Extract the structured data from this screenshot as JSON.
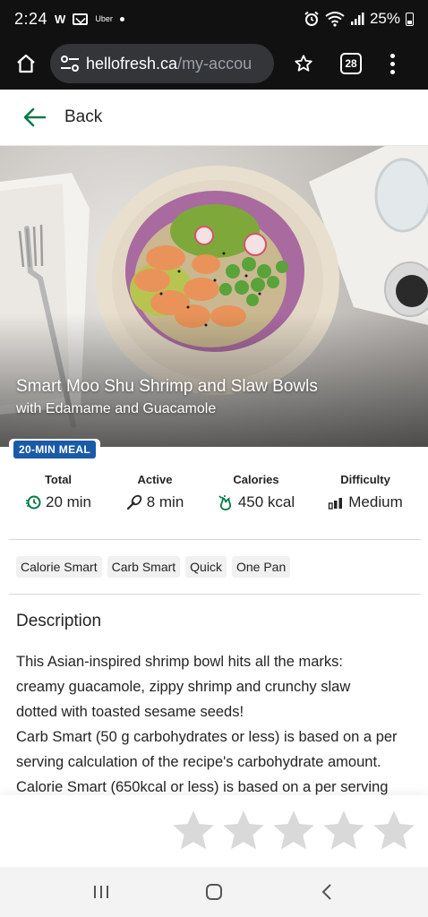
{
  "status_bar": {
    "time": "2:24",
    "app_letter": "W",
    "uber_label": "Uber",
    "battery": "25%"
  },
  "browser": {
    "url_host": "hellofresh.ca",
    "url_path": "/my-accou",
    "tab_count": "28",
    "icons": [
      "home-icon",
      "site-settings-icon",
      "bookmark-star-icon",
      "tab-switcher-icon",
      "overflow-menu-icon"
    ]
  },
  "nav": {
    "back_label": "Back"
  },
  "recipe": {
    "title": "Smart Moo Shu Shrimp and Slaw Bowls",
    "subtitle": "with Edamame and Guacamole",
    "badge": "20-MIN MEAL"
  },
  "stats": [
    {
      "label": "Total",
      "value": "20 min",
      "icon": "timer-icon"
    },
    {
      "label": "Active",
      "value": "8 min",
      "icon": "whisk-icon"
    },
    {
      "label": "Calories",
      "value": "450 kcal",
      "icon": "calorie-icon"
    },
    {
      "label": "Difficulty",
      "value": "Medium",
      "icon": "difficulty-bars-icon"
    }
  ],
  "tags": [
    "Calorie Smart",
    "Carb Smart",
    "Quick",
    "One Pan"
  ],
  "description": {
    "heading": "Description",
    "lines": [
      "This Asian-inspired shrimp bowl hits all the marks:",
      "creamy guacamole, zippy shrimp and crunchy slaw",
      "dotted with toasted sesame seeds!",
      "Carb Smart (50 g carbohydrates or less) is based on a per",
      "serving calculation of the recipe's carbohydrate amount.",
      "Calorie Smart (650kcal or less) is based on a per serving"
    ]
  },
  "rating": {
    "max": 5,
    "filled": 0,
    "star_color": "#d9d9d9"
  },
  "colors": {
    "accent": "#067a46",
    "badge": "#1a5ba8",
    "status_bg": "#111111"
  }
}
